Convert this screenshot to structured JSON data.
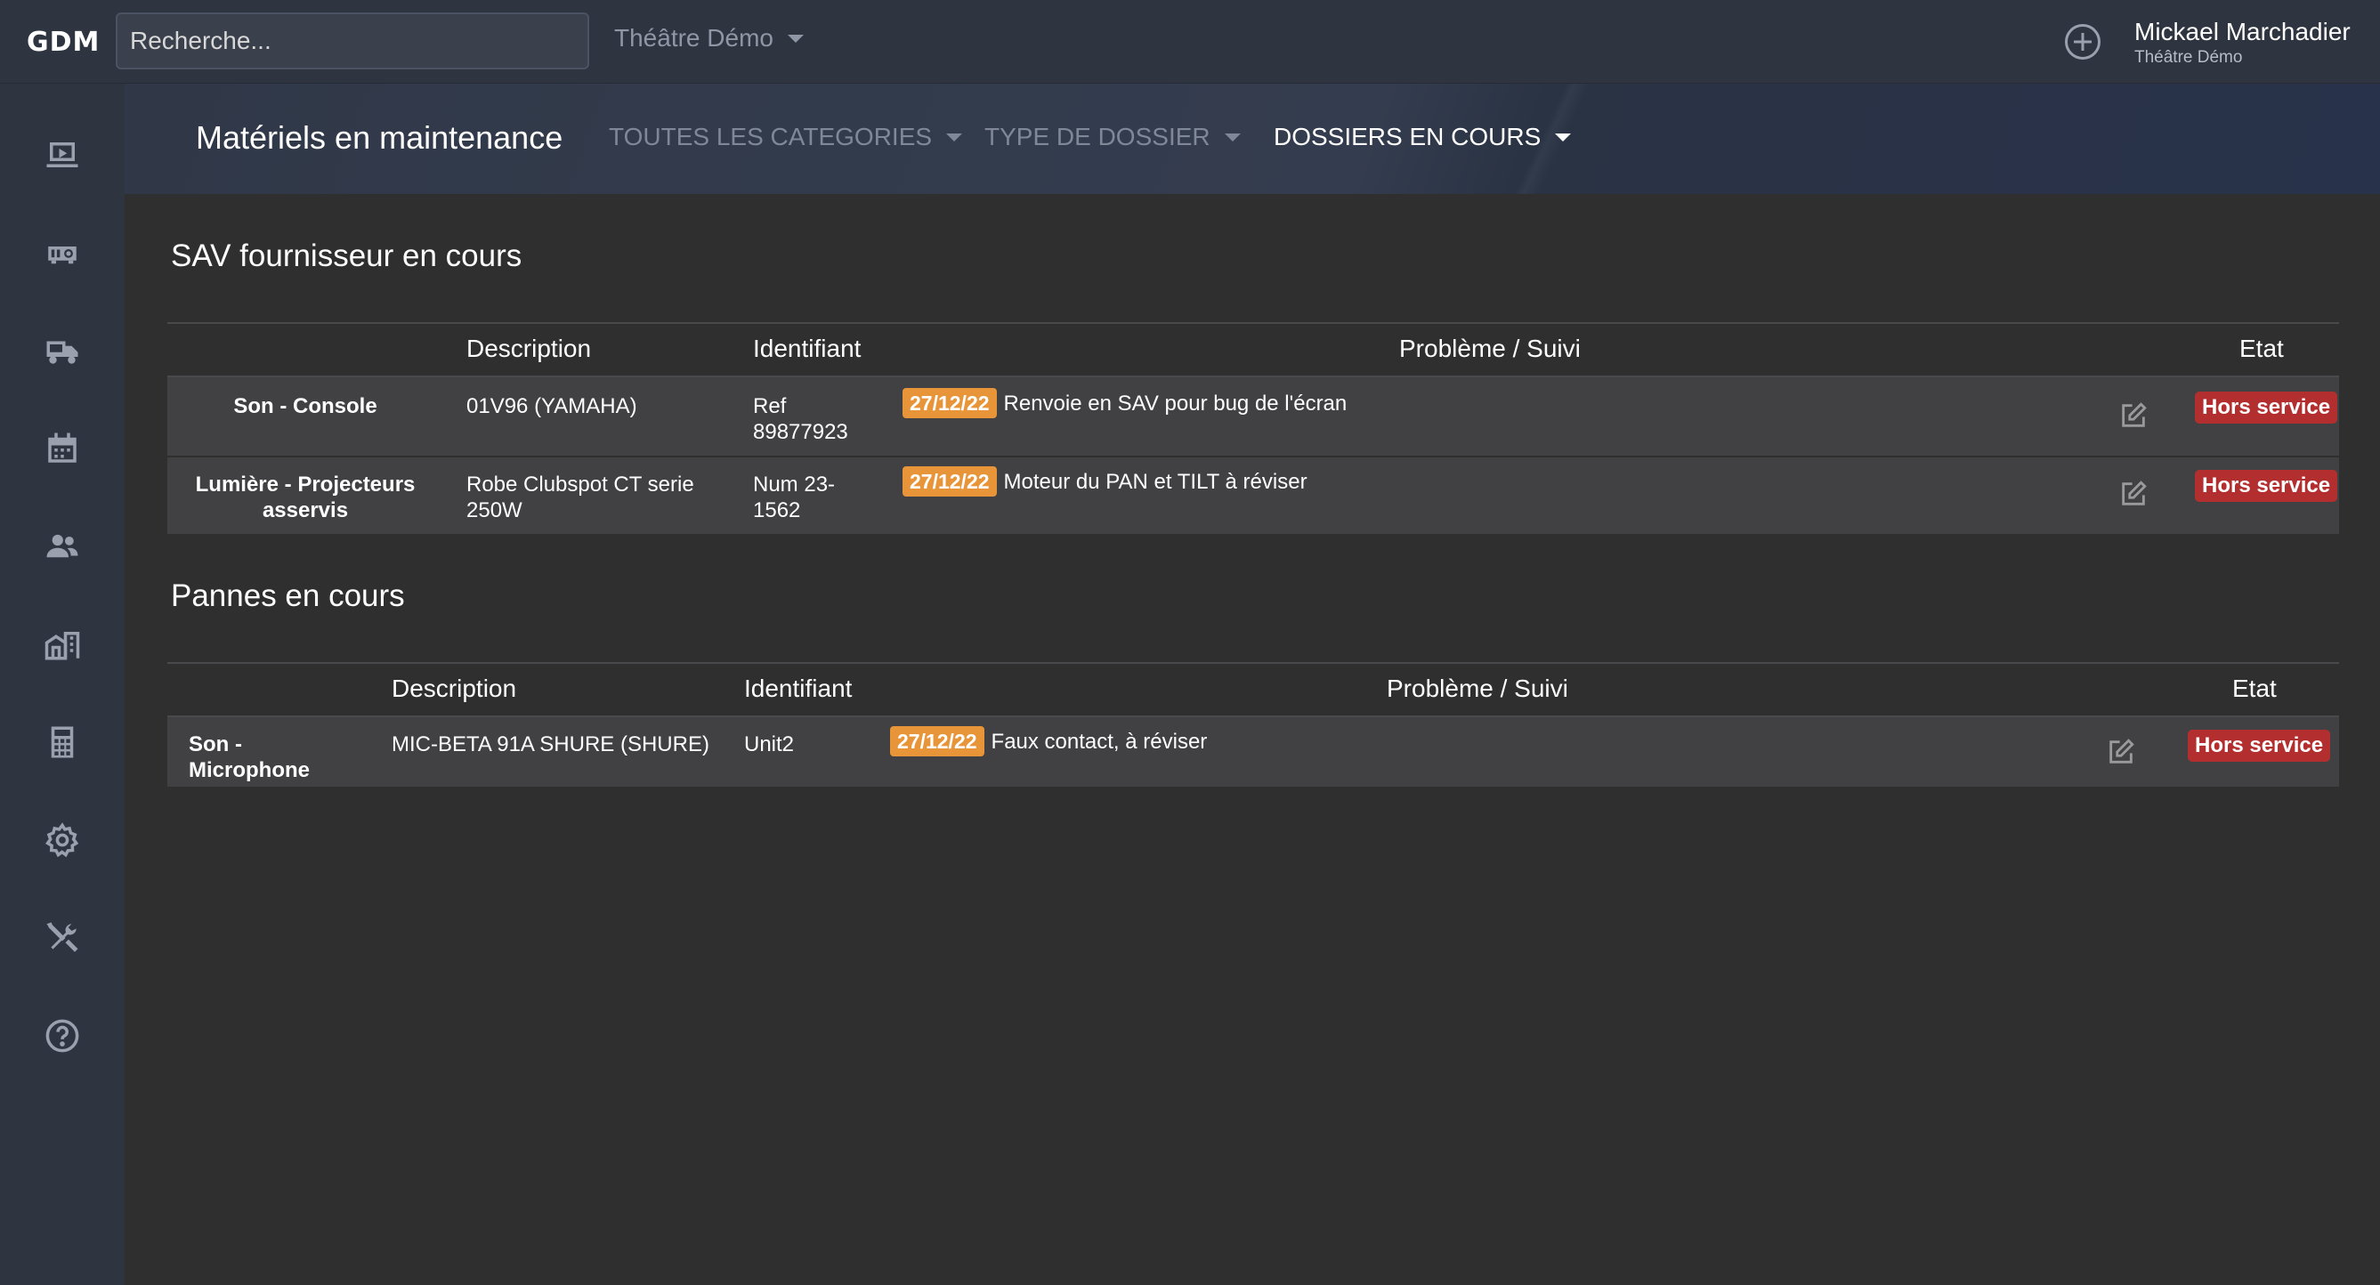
{
  "topbar": {
    "logo": "GDM",
    "search_placeholder": "Recherche...",
    "site_selector": "Théâtre Démo",
    "user_name": "Mickael Marchadier",
    "user_site": "Théâtre Démo"
  },
  "sidebar": {
    "icons": [
      "dashboard-icon",
      "equipment-icon",
      "vehicle-icon",
      "calendar-icon",
      "people-icon",
      "building-icon",
      "calculator-icon",
      "settings-icon",
      "tools-icon",
      "help-icon"
    ]
  },
  "subheader": {
    "title": "Matériels en maintenance",
    "filters": [
      "TOUTES LES CATEGORIES",
      "TYPE DE DOSSIER",
      "DOSSIERS EN COURS"
    ]
  },
  "sections": [
    {
      "title": "SAV fournisseur en cours",
      "headers": [
        "Description",
        "Identifiant",
        "Problème / Suivi",
        "Etat"
      ],
      "rows": [
        {
          "category": "Son - Console",
          "description": "01V96 (YAMAHA)",
          "identifier": "Ref 89877923",
          "date": "27/12/22",
          "problem": "Renvoie en SAV pour bug de l'écran",
          "status": "Hors service"
        },
        {
          "category": "Lumière - Projecteurs asservis",
          "description": "Robe Clubspot CT serie 250W",
          "identifier": "Num 23-1562",
          "date": "27/12/22",
          "problem": "Moteur du PAN et TILT à réviser",
          "status": "Hors service"
        }
      ]
    },
    {
      "title": "Pannes en cours",
      "headers": [
        "Description",
        "Identifiant",
        "Problème / Suivi",
        "Etat"
      ],
      "rows": [
        {
          "category": "Son - Microphone",
          "description": "MIC-BETA 91A SHURE (SHURE)",
          "identifier": "Unit2",
          "date": "27/12/22",
          "problem": "Faux contact, à réviser",
          "status": "Hors service"
        }
      ]
    }
  ],
  "colors": {
    "date_badge": "#e8953a",
    "status_badge": "#b32f2f",
    "topbar_bg": "#2e3440",
    "content_bg": "#2f2f30"
  }
}
